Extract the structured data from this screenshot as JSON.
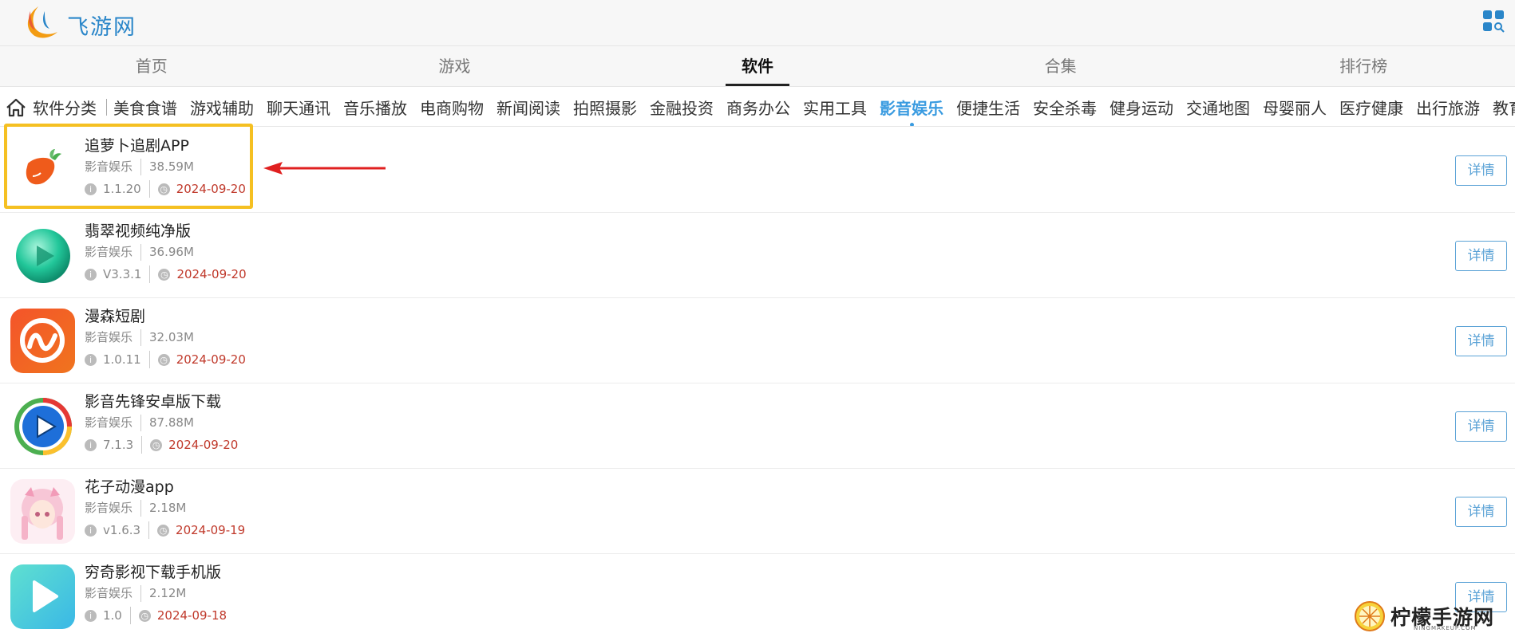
{
  "header": {
    "site_name": "飞游网"
  },
  "main_nav": {
    "tabs": [
      {
        "label": "首页",
        "active": false
      },
      {
        "label": "游戏",
        "active": false
      },
      {
        "label": "软件",
        "active": true
      },
      {
        "label": "合集",
        "active": false
      },
      {
        "label": "排行榜",
        "active": false
      }
    ]
  },
  "sub_nav": {
    "title": "软件分类",
    "items": [
      {
        "label": "美食食谱"
      },
      {
        "label": "游戏辅助"
      },
      {
        "label": "聊天通讯"
      },
      {
        "label": "音乐播放"
      },
      {
        "label": "电商购物"
      },
      {
        "label": "新闻阅读"
      },
      {
        "label": "拍照摄影"
      },
      {
        "label": "金融投资"
      },
      {
        "label": "商务办公"
      },
      {
        "label": "实用工具"
      },
      {
        "label": "影音娱乐",
        "active": true
      },
      {
        "label": "便捷生活"
      },
      {
        "label": "安全杀毒"
      },
      {
        "label": "健身运动"
      },
      {
        "label": "交通地图"
      },
      {
        "label": "母婴丽人"
      },
      {
        "label": "医疗健康"
      },
      {
        "label": "出行旅游"
      },
      {
        "label": "教育学"
      }
    ]
  },
  "apps": [
    {
      "name": "追萝卜追剧APP",
      "category": "影音娱乐",
      "size": "38.59M",
      "version": "1.1.20",
      "date": "2024-09-20",
      "detail_label": "详情",
      "icon": "carrot-icon"
    },
    {
      "name": "翡翠视频纯净版",
      "category": "影音娱乐",
      "size": "36.96M",
      "version": "V3.3.1",
      "date": "2024-09-20",
      "detail_label": "详情",
      "icon": "green-play-orb-icon"
    },
    {
      "name": "漫森短剧",
      "category": "影音娱乐",
      "size": "32.03M",
      "version": "1.0.11",
      "date": "2024-09-20",
      "detail_label": "详情",
      "icon": "orange-m-icon"
    },
    {
      "name": "影音先锋安卓版下载",
      "category": "影音娱乐",
      "size": "87.88M",
      "version": "7.1.3",
      "date": "2024-09-20",
      "detail_label": "详情",
      "icon": "blue-play-ring-icon"
    },
    {
      "name": "花子动漫app",
      "category": "影音娱乐",
      "size": "2.18M",
      "version": "v1.6.3",
      "date": "2024-09-19",
      "detail_label": "详情",
      "icon": "anime-girl-icon"
    },
    {
      "name": "穷奇影视下载手机版",
      "category": "影音娱乐",
      "size": "2.12M",
      "version": "1.0",
      "date": "2024-09-18",
      "detail_label": "详情",
      "icon": "cyan-play-icon"
    }
  ],
  "watermark": {
    "text": "柠檬手游网",
    "sub": "NINGMAKEUP.COM"
  },
  "colors": {
    "accent": "#3a9be0",
    "date_red": "#c0392b",
    "highlight": "#f5c022",
    "arrow": "#e02020"
  }
}
